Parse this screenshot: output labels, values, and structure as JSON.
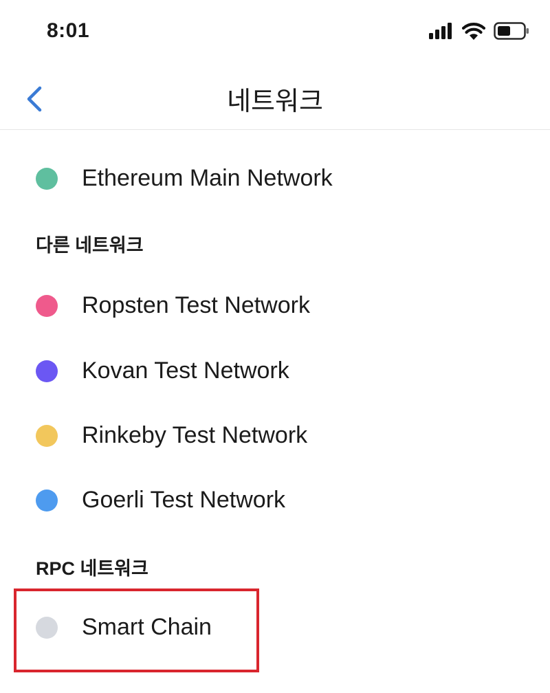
{
  "status_bar": {
    "time": "8:01",
    "icons": [
      "cellular-signal-icon",
      "wifi-icon",
      "battery-icon"
    ]
  },
  "header": {
    "title": "네트워크",
    "back_icon": "chevron-left-icon",
    "accent_color": "#3a7bd5"
  },
  "main_network": {
    "label": "Ethereum Main Network",
    "color": "#5fbf9f"
  },
  "other_networks": {
    "header": "다른 네트워크",
    "items": [
      {
        "label": "Ropsten Test Network",
        "color": "#ef5a8c"
      },
      {
        "label": "Kovan Test Network",
        "color": "#6b57f3"
      },
      {
        "label": "Rinkeby Test Network",
        "color": "#f2c75c"
      },
      {
        "label": "Goerli Test Network",
        "color": "#4e9bef"
      }
    ]
  },
  "rpc_networks": {
    "header": "RPC 네트워크",
    "items": [
      {
        "label": "Smart Chain",
        "color": "#d6d9df"
      }
    ]
  },
  "annotation": {
    "highlight_color": "#d9262e"
  }
}
